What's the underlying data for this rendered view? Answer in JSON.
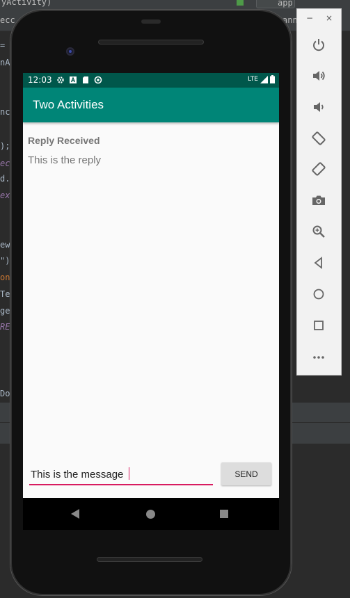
{
  "ide": {
    "title_fragment": "yActivity)",
    "run_config": "app",
    "left_tab_fragment": "ecc",
    "right_tab_fragment": "ann",
    "code_fragments": [
      {
        "text": "=",
        "style": "normal"
      },
      {
        "text": "nA",
        "style": "normal"
      },
      {
        "text": "nc",
        "style": "normal"
      },
      {
        "text": ");",
        "style": "normal"
      },
      {
        "text": "ec",
        "style": "purple"
      },
      {
        "text": "d.",
        "style": "normal"
      },
      {
        "text": "ext",
        "style": "purple"
      },
      {
        "text": "ew)",
        "style": "normal"
      },
      {
        "text": "\")",
        "style": "normal"
      },
      {
        "text": "on",
        "style": "orange"
      },
      {
        "text": "Te",
        "style": "normal"
      },
      {
        "text": "ge)",
        "style": "normal"
      },
      {
        "text": "REQ",
        "style": "purple"
      },
      {
        "text": "Doc",
        "style": "normal"
      }
    ]
  },
  "emulator": {
    "panel_controls": {
      "minimize": "−",
      "close": "×"
    },
    "buttons": [
      {
        "name": "power-icon"
      },
      {
        "name": "volume-up-icon"
      },
      {
        "name": "volume-down-icon"
      },
      {
        "name": "rotate-left-icon"
      },
      {
        "name": "rotate-right-icon"
      },
      {
        "name": "camera-icon"
      },
      {
        "name": "zoom-icon"
      },
      {
        "name": "back-icon"
      },
      {
        "name": "home-icon"
      },
      {
        "name": "overview-icon"
      },
      {
        "name": "more-icon"
      }
    ]
  },
  "device": {
    "status_bar": {
      "time": "12:03",
      "network": "LTE",
      "icons": [
        "settings-icon",
        "a-icon",
        "sd-card-icon",
        "sync-icon"
      ]
    },
    "app_bar": {
      "title": "Two Activities"
    },
    "content": {
      "reply_header": "Reply Received",
      "reply_text": "This is the reply"
    },
    "composer": {
      "input_value": "This is the message",
      "send_label": "SEND"
    },
    "nav_bar": [
      "back",
      "home",
      "recents"
    ]
  },
  "colors": {
    "status_bar": "#00574b",
    "app_bar": "#008577",
    "accent": "#d81b60"
  }
}
